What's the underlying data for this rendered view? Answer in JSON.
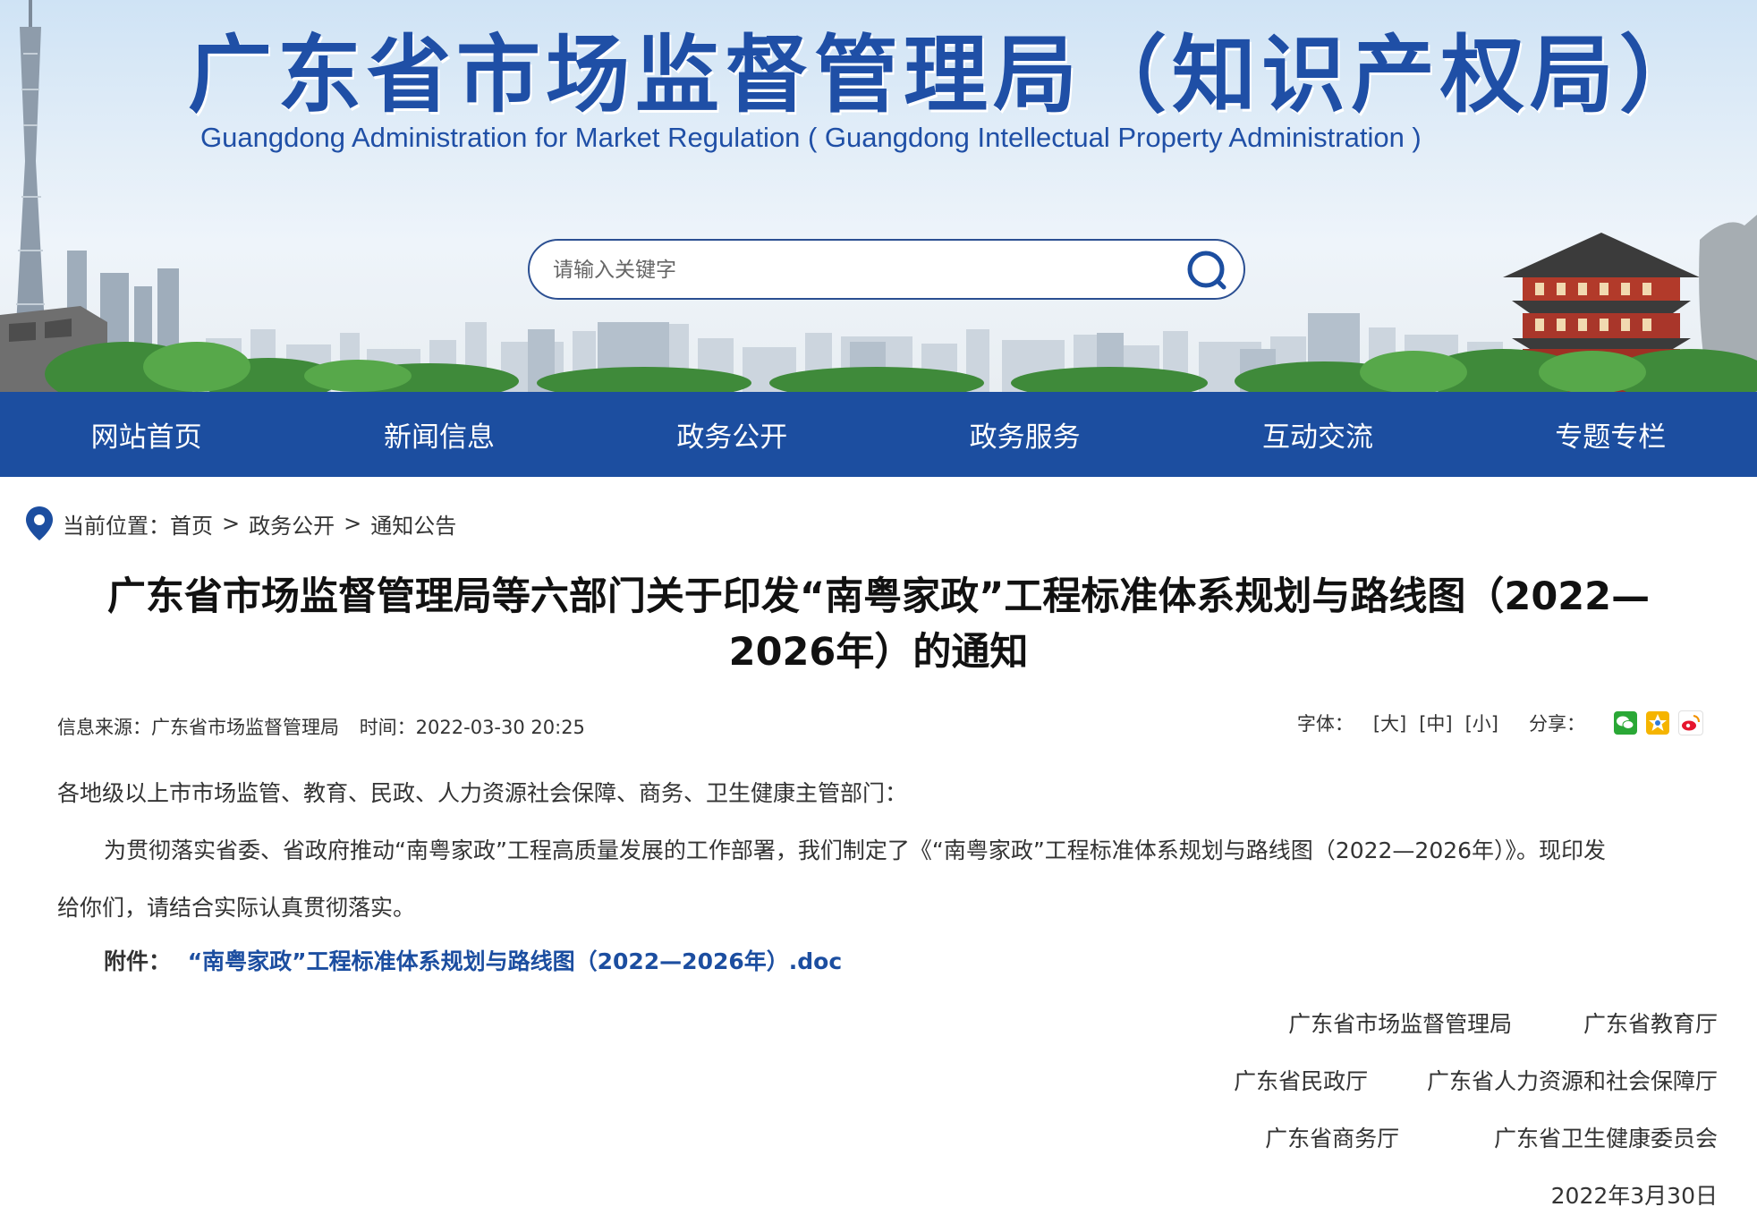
{
  "header": {
    "title": "广东省市场监督管理局（知识产权局）",
    "subtitle": "Guangdong Administration for Market Regulation ( Guangdong Intellectual Property Administration )"
  },
  "search": {
    "placeholder": "请输入关键字"
  },
  "nav": {
    "items": [
      {
        "label": "网站首页"
      },
      {
        "label": "新闻信息"
      },
      {
        "label": "政务公开"
      },
      {
        "label": "政务服务"
      },
      {
        "label": "互动交流"
      },
      {
        "label": "专题专栏"
      }
    ]
  },
  "breadcrumb": {
    "label": "当前位置：",
    "items": [
      "首页",
      "政务公开",
      "通知公告"
    ],
    "separator": ">"
  },
  "article": {
    "title_line1": "广东省市场监督管理局等六部门关于印发“南粤家政”工程标准体系规划与路线图（2022—",
    "title_line2": "2026年）的通知",
    "source_label": "信息来源：广东省市场监督管理局",
    "time_label": "时间：2022-03-30 20:25",
    "font_label": "字体：",
    "font_sizes": [
      "[大]",
      "[中]",
      "[小]"
    ],
    "share_label": "分享：",
    "share_icons": [
      "wechat-icon",
      "qzone-icon",
      "weibo-icon"
    ],
    "salutation": "各地级以上市市场监管、教育、民政、人力资源社会保障、商务、卫生健康主管部门：",
    "body_line1": "为贯彻落实省委、省政府推动“南粤家政”工程高质量发展的工作部署，我们制定了《“南粤家政”工程标准体系规划与路线图（2022—2026年）》。现印发",
    "body_line2": "给你们，请结合实际认真贯彻落实。",
    "attachment_label": "附件：",
    "attachment_link": "“南粤家政”工程标准体系规划与路线图（2022—2026年）.doc",
    "signatories": [
      [
        "广东省市场监督管理局",
        "广东省教育厅"
      ],
      [
        "广东省民政厅",
        "广东省人力资源和社会保障厅"
      ],
      [
        "广东省商务厅",
        "广东省卫生健康委员会"
      ]
    ],
    "date": "2022年3月30日"
  },
  "colors": {
    "brand_blue": "#1c4ea0",
    "title_blue": "#1f4fa6"
  }
}
